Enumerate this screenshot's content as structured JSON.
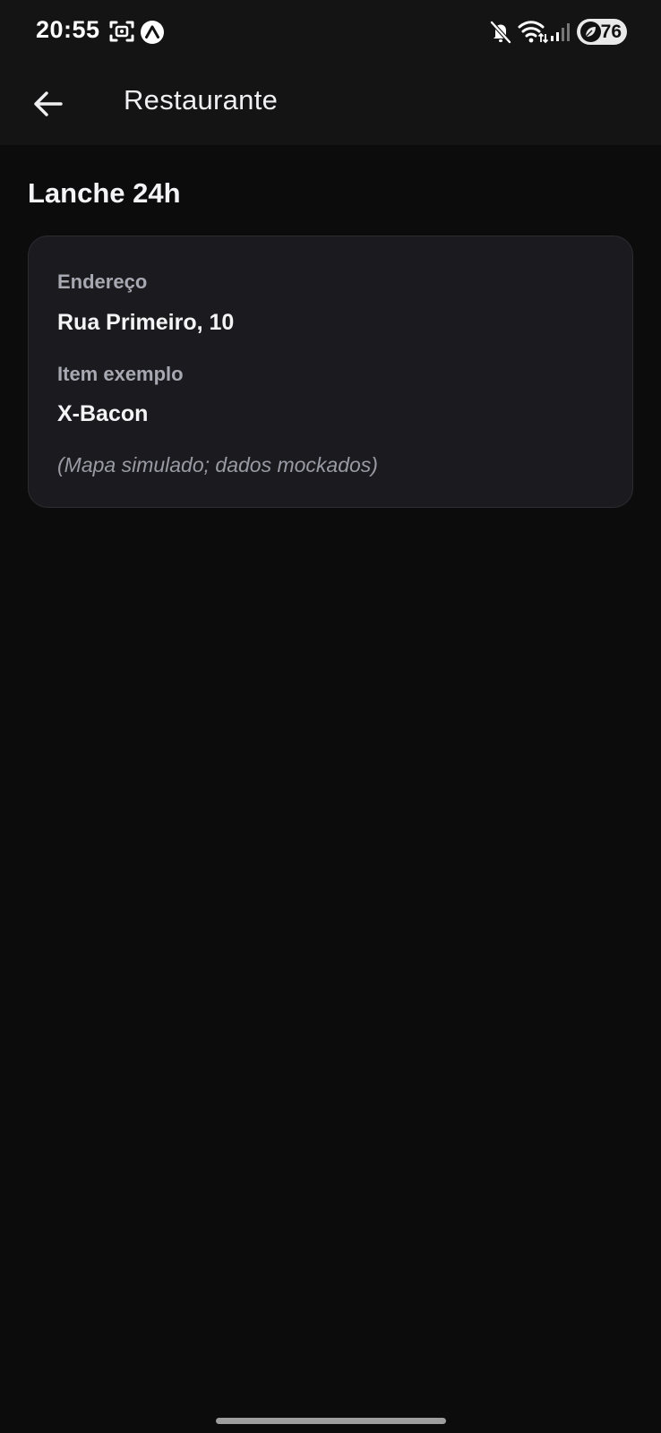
{
  "status_bar": {
    "time": "20:55",
    "battery_level": "76",
    "icons": [
      "screenshot-icon",
      "expo-icon",
      "mute-icon",
      "wifi-icon",
      "signal-icon",
      "battery-icon"
    ]
  },
  "app_bar": {
    "title": "Restaurante",
    "back_icon": "arrow-left-icon"
  },
  "restaurant": {
    "name": "Lanche 24h",
    "address_label": "Endereço",
    "address_value": "Rua Primeiro, 10",
    "item_label": "Item exemplo",
    "item_value": "X-Bacon",
    "note": "(Mapa simulado; dados mockados)"
  },
  "colors": {
    "background": "#0c0c0d",
    "surface": "#1b1b1f",
    "text_primary": "#f4f4f6",
    "text_secondary": "#a8a8b2"
  }
}
